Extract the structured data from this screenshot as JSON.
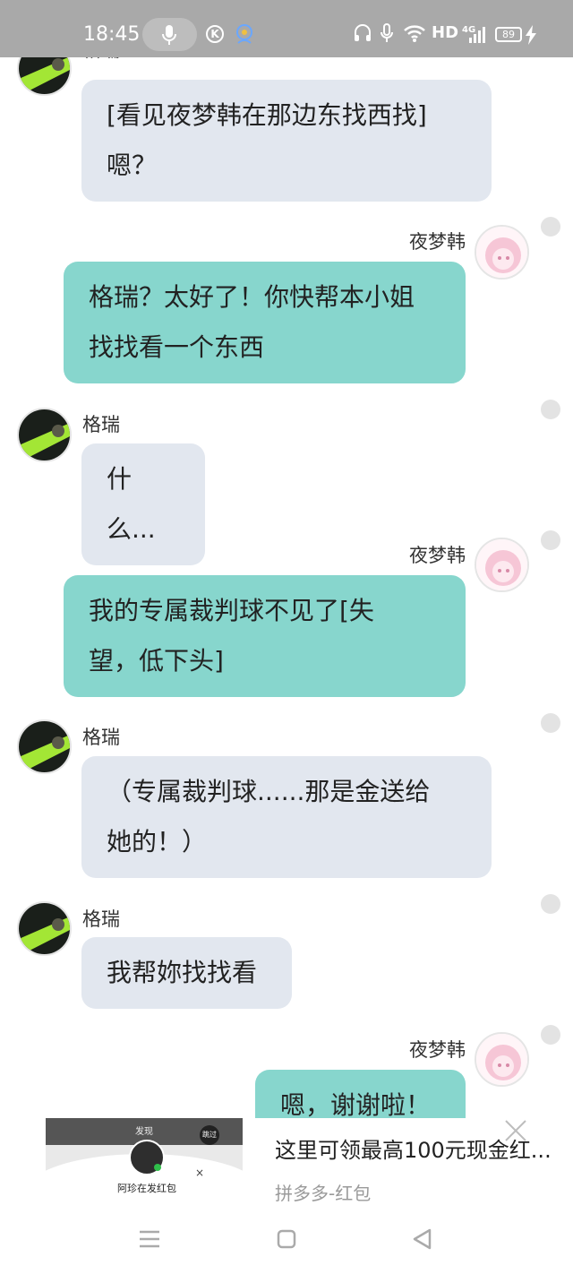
{
  "status_bar": {
    "time": "18:45",
    "network": "HD",
    "signal_label": "4G",
    "battery": "89",
    "icons": [
      "mic-icon",
      "k-icon",
      "assistant-icon",
      "headphones-icon",
      "mic-icon",
      "wifi-icon",
      "signal-icon",
      "battery-icon",
      "charging-icon"
    ]
  },
  "chat": {
    "messages": [
      {
        "sender": "格瑞",
        "side": "left",
        "text_lines": [
          "[看见夜梦韩在那边东找西找]",
          "嗯？"
        ]
      },
      {
        "sender": "夜梦韩",
        "side": "right",
        "text_lines": [
          "格瑞？太好了！你快帮本小姐",
          "找找看一个东西"
        ]
      },
      {
        "sender": "格瑞",
        "side": "left",
        "text_lines": [
          "什么..."
        ]
      },
      {
        "sender": "夜梦韩",
        "side": "right",
        "text_lines": [
          "我的专属裁判球不见了[失",
          "望，低下头]"
        ]
      },
      {
        "sender": "格瑞",
        "side": "left",
        "text_lines": [
          "（专属裁判球......那是金送给",
          "她的！）"
        ]
      },
      {
        "sender": "格瑞",
        "side": "left",
        "text_lines": [
          "我帮妳找找看"
        ]
      },
      {
        "sender": "夜梦韩",
        "side": "right",
        "text_lines": [
          "嗯，谢谢啦！"
        ]
      }
    ]
  },
  "ad": {
    "title": "这里可领最高100元现金红...",
    "source": "拼多多-红包",
    "thumb_caption": "阿珍在发红包",
    "thumb_header": "发现",
    "thumb_button": "跳过"
  },
  "nav_bar": {
    "icons": [
      "menu-icon",
      "home-icon",
      "back-icon"
    ]
  },
  "colors": {
    "status_bar": "#a9a9a9",
    "bubble_left": "#e2e7ef",
    "bubble_right": "#87d6cd"
  }
}
